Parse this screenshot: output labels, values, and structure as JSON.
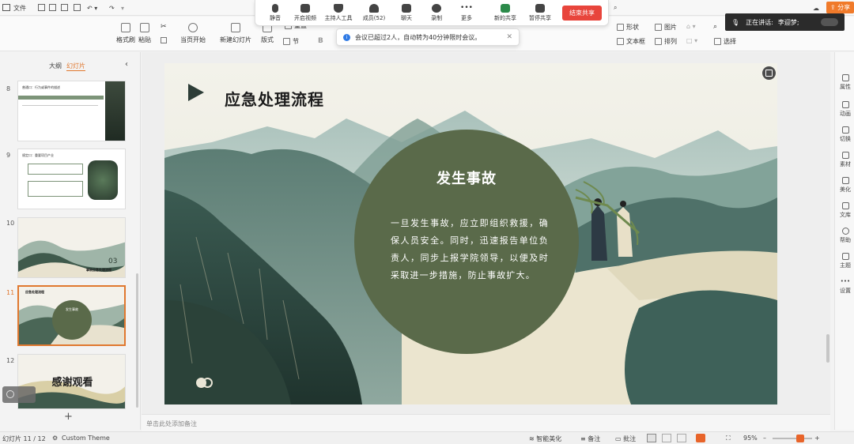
{
  "titlebar": {
    "menu_file": "文件",
    "share_label": "分享"
  },
  "meeting": {
    "mute": "静音",
    "camera": "开启视频",
    "host_tools": "主持人工具",
    "members": "成员(52)",
    "chat": "聊天",
    "record": "录制",
    "more": "更多",
    "new_share": "新的共享",
    "pause_share": "暂停共享",
    "end_share": "结束共享",
    "speaking_label": "正在讲话:",
    "speaker_name": "李迎梦;"
  },
  "ribbon": {
    "format_painter": "格式刷",
    "paste": "粘贴",
    "from_start": "当页开始",
    "new_slide": "新建幻灯片",
    "layout": "版式",
    "section": "节",
    "reset": "重置",
    "shape": "形状",
    "picture": "图片",
    "textbox": "文本框",
    "arrange": "排列",
    "select": "选择"
  },
  "toast": {
    "message": "会议已超过2人，自动转为40分钟限时会议。"
  },
  "leftpane": {
    "tab_outline": "大纲",
    "tab_slides": "幻灯片",
    "thumbs": [
      {
        "num": "8",
        "title": "普通口：行为或事件的描述"
      },
      {
        "num": "9",
        "title": "规定口：重要项目产业"
      },
      {
        "num": "10",
        "section_num": "03",
        "section_title": "事故应急处理流程"
      },
      {
        "num": "11",
        "title": "应急处理流程",
        "circle_title": "发生事故"
      },
      {
        "num": "12",
        "title": "感谢观看"
      }
    ],
    "add_label": "+"
  },
  "slide": {
    "title": "应急处理流程",
    "circle_title": "发生事故",
    "circle_body": "一旦发生事故，应立即组织救援，确保人员安全。同时，迅速报告单位负责人，同步上报学院领导，以便及时采取进一步措施，防止事故扩大。"
  },
  "notes": {
    "placeholder": "单击此处添加备注"
  },
  "rightbar": {
    "items": [
      "属性",
      "动画",
      "切换",
      "素材",
      "美化",
      "文库",
      "帮助",
      "主题",
      "设置"
    ]
  },
  "statusbar": {
    "slide_counter": "幻灯片 11 / 12",
    "theme": "Custom Theme",
    "smart_beautify": "智能美化",
    "notes_btn": "备注",
    "comments_btn": "批注",
    "zoom": "95%"
  },
  "colors": {
    "accent": "#e0782f",
    "end_share": "#e8453c",
    "circle": "#5a6a4a"
  }
}
